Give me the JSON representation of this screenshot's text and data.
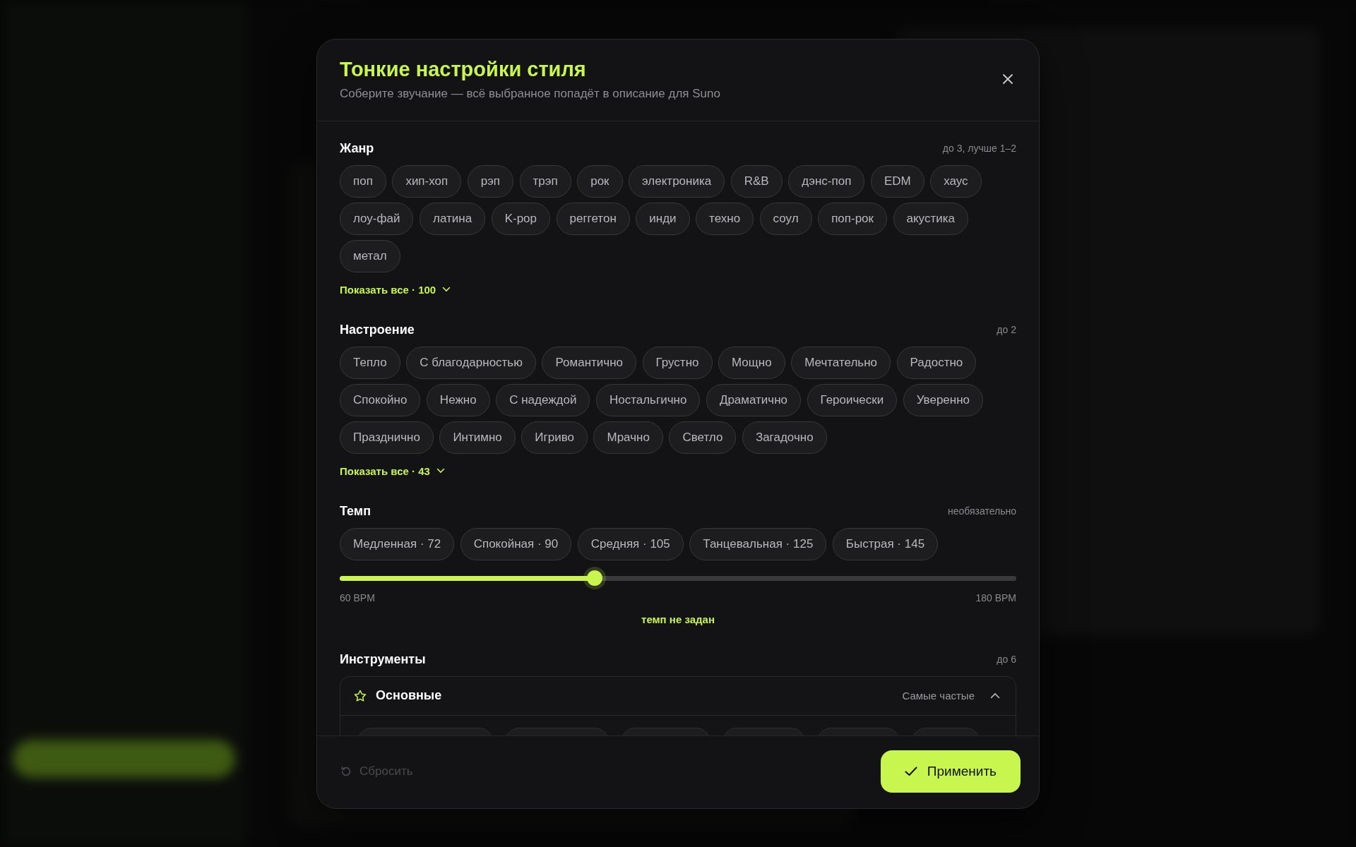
{
  "dialog": {
    "title": "Тонкие настройки стиля",
    "subtitle": "Соберите звучание — всё выбранное попадёт в описание для Suno"
  },
  "sections": [
    {
      "kind": "chips",
      "title": "Жанр",
      "hint": "до 3, лучше 1–2",
      "chips": [
        {
          "label": "поп",
          "selected": false
        },
        {
          "label": "хип-хоп",
          "selected": false
        },
        {
          "label": "рэп",
          "selected": false
        },
        {
          "label": "трэп",
          "selected": false
        },
        {
          "label": "рок",
          "selected": false
        },
        {
          "label": "электроника",
          "selected": false
        },
        {
          "label": "R&B",
          "selected": false
        },
        {
          "label": "дэнс-поп",
          "selected": false
        },
        {
          "label": "EDM",
          "selected": false
        },
        {
          "label": "хаус",
          "selected": false
        },
        {
          "label": "лоу-фай",
          "selected": false
        },
        {
          "label": "латина",
          "selected": false
        },
        {
          "label": "K-pop",
          "selected": false
        },
        {
          "label": "реггетон",
          "selected": false
        },
        {
          "label": "инди",
          "selected": false
        },
        {
          "label": "техно",
          "selected": false
        },
        {
          "label": "соул",
          "selected": false
        },
        {
          "label": "поп-рок",
          "selected": false
        },
        {
          "label": "акустика",
          "selected": false
        },
        {
          "label": "метал",
          "selected": false
        }
      ],
      "show_all": "Показать все · 100"
    },
    {
      "kind": "chips",
      "title": "Настроение",
      "hint": "до 2",
      "chips": [
        {
          "label": "Тепло",
          "selected": false
        },
        {
          "label": "С благодарностью",
          "selected": false
        },
        {
          "label": "Романтично",
          "selected": false
        },
        {
          "label": "Грустно",
          "selected": false
        },
        {
          "label": "Мощно",
          "selected": false
        },
        {
          "label": "Мечтательно",
          "selected": false
        },
        {
          "label": "Радостно",
          "selected": false
        },
        {
          "label": "Спокойно",
          "selected": false
        },
        {
          "label": "Нежно",
          "selected": false
        },
        {
          "label": "С надеждой",
          "selected": false
        },
        {
          "label": "Ностальгично",
          "selected": false
        },
        {
          "label": "Драматично",
          "selected": false
        },
        {
          "label": "Героически",
          "selected": false
        },
        {
          "label": "Уверенно",
          "selected": false
        },
        {
          "label": "Празднично",
          "selected": false
        },
        {
          "label": "Интимно",
          "selected": false
        },
        {
          "label": "Игриво",
          "selected": false
        },
        {
          "label": "Мрачно",
          "selected": false
        },
        {
          "label": "Светло",
          "selected": false
        },
        {
          "label": "Загадочно",
          "selected": false
        }
      ],
      "show_all": "Показать все · 43"
    },
    {
      "kind": "tempo",
      "title": "Темп",
      "hint": "необязательно",
      "chips": [
        {
          "label": "Медленная · 72",
          "selected": false
        },
        {
          "label": "Спокойная · 90",
          "selected": false
        },
        {
          "label": "Средняя · 105",
          "selected": false
        },
        {
          "label": "Танцевальная · 125",
          "selected": false
        },
        {
          "label": "Быстрая · 145",
          "selected": false
        }
      ],
      "slider": {
        "level": 0.377,
        "min_label": "60 BPM",
        "max_label": "180 BPM"
      },
      "status": "темп не задан"
    },
    {
      "kind": "groups",
      "title": "Инструменты",
      "hint": "до 6",
      "groups": [
        {
          "title": "Основные",
          "note": "Самые частые",
          "expanded": true
        }
      ]
    }
  ],
  "footer": {
    "reset": {
      "label": "Сбросить",
      "disabled": true
    },
    "apply": "Применить"
  }
}
